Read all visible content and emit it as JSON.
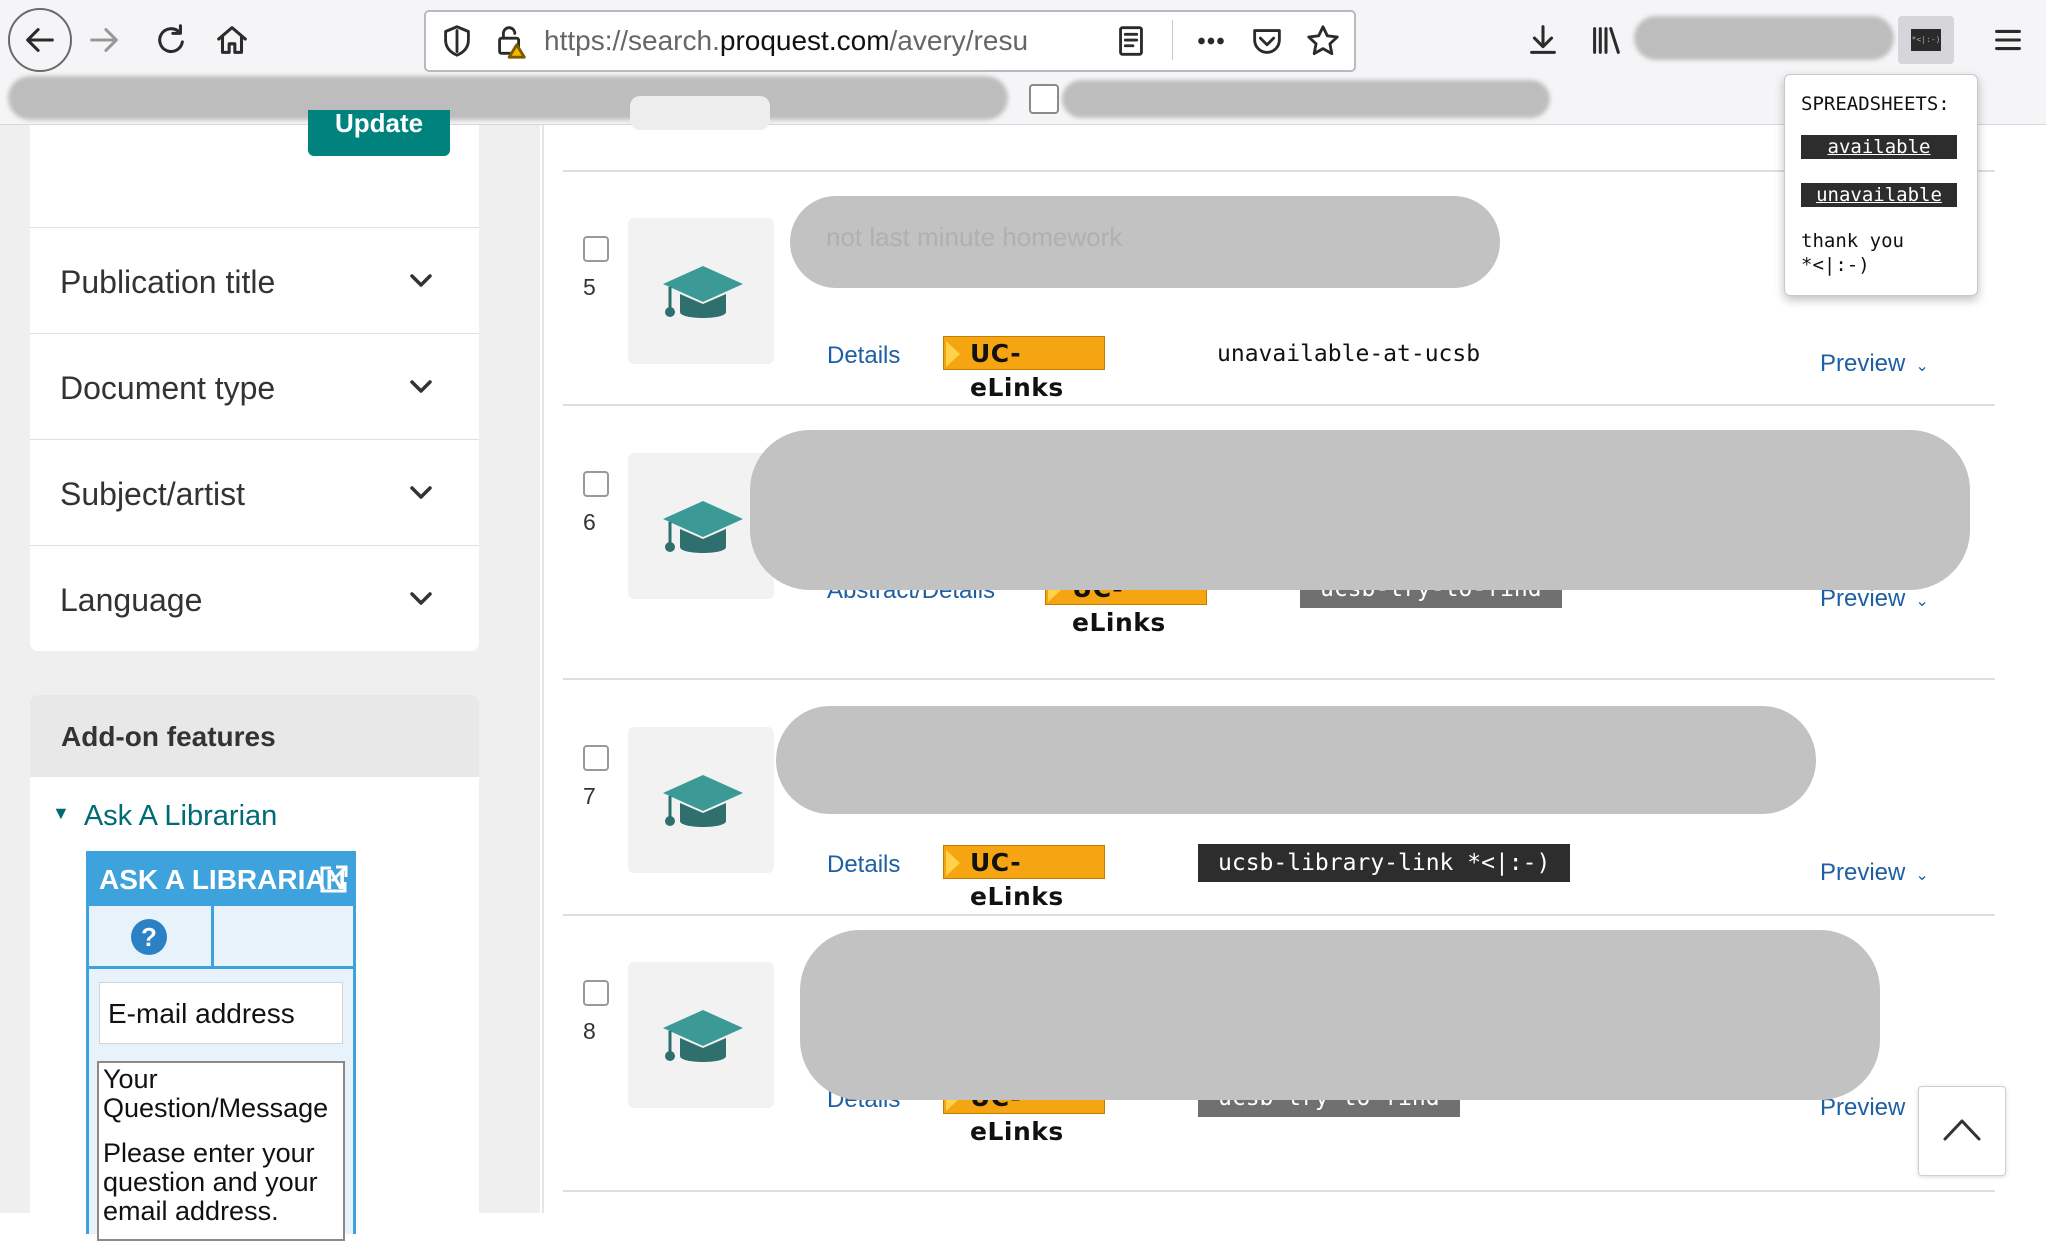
{
  "browser": {
    "url_host_prefix": "https://search.",
    "url_host": "proquest.com",
    "url_path": "/avery/resu",
    "extension_popup": {
      "title": "SPREADSHEETS:",
      "badge_available": "available",
      "badge_unavailable": "unavailable",
      "thanks": "thank you\n*<|:-)"
    }
  },
  "sidebar": {
    "update_label": "Update",
    "filters": [
      {
        "label": "Publication title"
      },
      {
        "label": "Document type"
      },
      {
        "label": "Subject/artist"
      },
      {
        "label": "Language"
      }
    ],
    "addon_title": "Add-on features",
    "ask_toggle": "Ask A Librarian",
    "widget": {
      "title": "ASK A LIBRARIAN",
      "help_glyph": "?",
      "email_placeholder": "E-mail address",
      "message_label": "Your Question/Message",
      "message_hint": "Please enter your question and your email address."
    }
  },
  "results": [
    {
      "number": "5",
      "link": "Details",
      "uc": "UC-eLinks",
      "status": "unavailable-at-ucsb",
      "status_style": "plain",
      "preview": "Preview",
      "ghost_title": "not last minute homework"
    },
    {
      "number": "6",
      "link": "Abstract/Details",
      "uc": "UC-eLinks",
      "status": "ucsb-try-to-find",
      "status_style": "grey",
      "preview": "Preview"
    },
    {
      "number": "7",
      "link": "Details",
      "uc": "UC-eLinks",
      "status": "ucsb-library-link *<|:-)",
      "status_style": "dark",
      "preview": "Preview"
    },
    {
      "number": "8",
      "link": "Details",
      "uc": "UC-eLinks",
      "status": "ucsb-try-to-find",
      "status_style": "grey",
      "preview": "Preview"
    }
  ],
  "colors": {
    "accent_teal": "#00837d",
    "link_blue": "#1e5fa3",
    "uc_orange": "#f5a512",
    "widget_blue": "#3ea2dd"
  }
}
